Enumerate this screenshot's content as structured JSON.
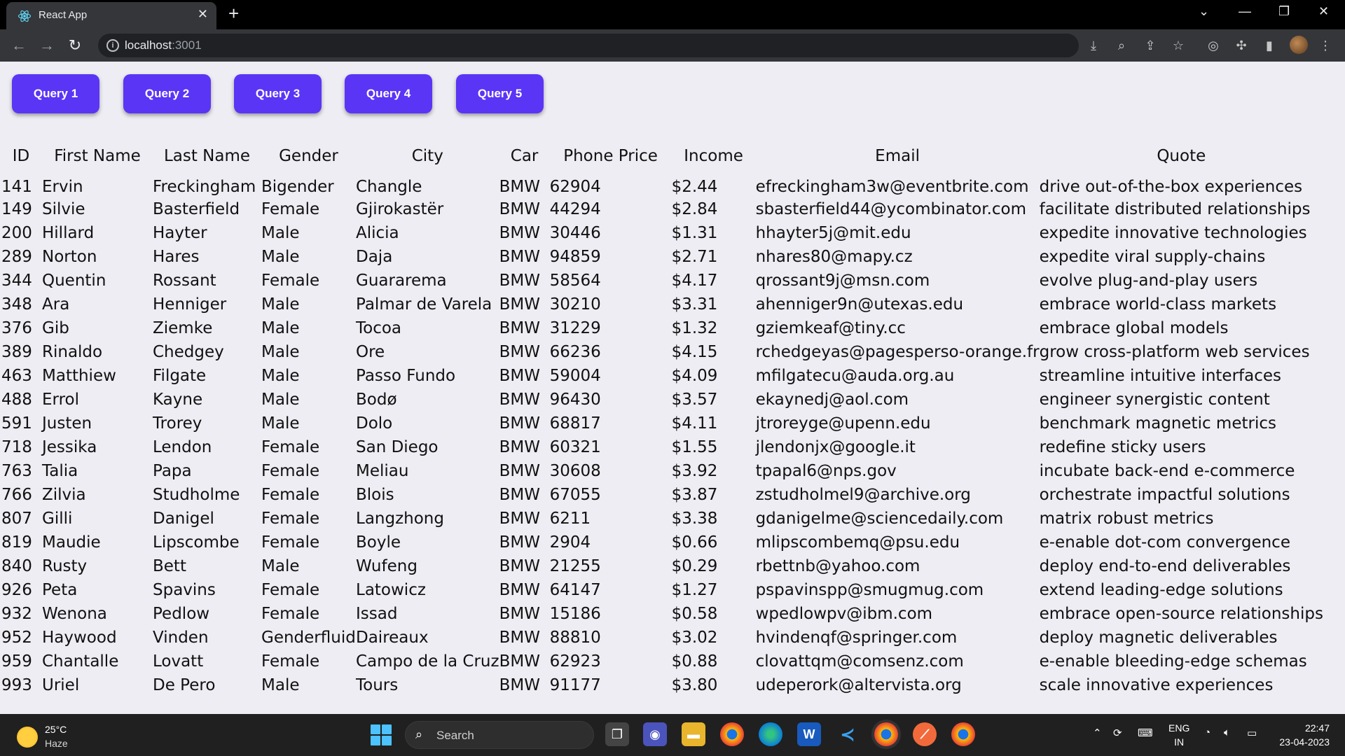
{
  "browser": {
    "tab_title": "React App",
    "tab_close": "✕",
    "new_tab": "+",
    "url_host": "localhost",
    "url_port": ":3001"
  },
  "queries": [
    "Query 1",
    "Query 2",
    "Query 3",
    "Query 4",
    "Query 5"
  ],
  "table": {
    "columns": [
      "ID",
      "First Name",
      "Last Name",
      "Gender",
      "City",
      "Car",
      "Phone Price",
      "Income",
      "Email",
      "Quote"
    ],
    "rows": [
      [
        "141",
        "Ervin",
        "Freckingham",
        "Bigender",
        "Changle",
        "BMW",
        "62904",
        "$2.44",
        "efreckingham3w@eventbrite.com",
        "drive out-of-the-box experiences"
      ],
      [
        "149",
        "Silvie",
        "Basterfield",
        "Female",
        "Gjirokastër",
        "BMW",
        "44294",
        "$2.84",
        "sbasterfield44@ycombinator.com",
        "facilitate distributed relationships"
      ],
      [
        "200",
        "Hillard",
        "Hayter",
        "Male",
        "Alicia",
        "BMW",
        "30446",
        "$1.31",
        "hhayter5j@mit.edu",
        "expedite innovative technologies"
      ],
      [
        "289",
        "Norton",
        "Hares",
        "Male",
        "Daja",
        "BMW",
        "94859",
        "$2.71",
        "nhares80@mapy.cz",
        "expedite viral supply-chains"
      ],
      [
        "344",
        "Quentin",
        "Rossant",
        "Female",
        "Guararema",
        "BMW",
        "58564",
        "$4.17",
        "qrossant9j@msn.com",
        "evolve plug-and-play users"
      ],
      [
        "348",
        "Ara",
        "Henniger",
        "Male",
        "Palmar de Varela",
        "BMW",
        "30210",
        "$3.31",
        "ahenniger9n@utexas.edu",
        "embrace world-class markets"
      ],
      [
        "376",
        "Gib",
        "Ziemke",
        "Male",
        "Tocoa",
        "BMW",
        "31229",
        "$1.32",
        "gziemkeaf@tiny.cc",
        "embrace global models"
      ],
      [
        "389",
        "Rinaldo",
        "Chedgey",
        "Male",
        "Ore",
        "BMW",
        "66236",
        "$4.15",
        "rchedgeyas@pagesperso-orange.fr",
        "grow cross-platform web services"
      ],
      [
        "463",
        "Matthiew",
        "Filgate",
        "Male",
        "Passo Fundo",
        "BMW",
        "59004",
        "$4.09",
        "mfilgatecu@auda.org.au",
        "streamline intuitive interfaces"
      ],
      [
        "488",
        "Errol",
        "Kayne",
        "Male",
        "Bodø",
        "BMW",
        "96430",
        "$3.57",
        "ekaynedj@aol.com",
        "engineer synergistic content"
      ],
      [
        "591",
        "Justen",
        "Trorey",
        "Male",
        "Dolo",
        "BMW",
        "68817",
        "$4.11",
        "jtroreyge@upenn.edu",
        "benchmark magnetic metrics"
      ],
      [
        "718",
        "Jessika",
        "Lendon",
        "Female",
        "San Diego",
        "BMW",
        "60321",
        "$1.55",
        "jlendonjx@google.it",
        "redefine sticky users"
      ],
      [
        "763",
        "Talia",
        "Papa",
        "Female",
        "Meliau",
        "BMW",
        "30608",
        "$3.92",
        "tpapal6@nps.gov",
        "incubate back-end e-commerce"
      ],
      [
        "766",
        "Zilvia",
        "Studholme",
        "Female",
        "Blois",
        "BMW",
        "67055",
        "$3.87",
        "zstudholmel9@archive.org",
        "orchestrate impactful solutions"
      ],
      [
        "807",
        "Gilli",
        "Danigel",
        "Female",
        "Langzhong",
        "BMW",
        "6211",
        "$3.38",
        "gdanigelme@sciencedaily.com",
        "matrix robust metrics"
      ],
      [
        "819",
        "Maudie",
        "Lipscombe",
        "Female",
        "Boyle",
        "BMW",
        "2904",
        "$0.66",
        "mlipscombemq@psu.edu",
        "e-enable dot-com convergence"
      ],
      [
        "840",
        "Rusty",
        "Bett",
        "Male",
        "Wufeng",
        "BMW",
        "21255",
        "$0.29",
        "rbettnb@yahoo.com",
        "deploy end-to-end deliverables"
      ],
      [
        "926",
        "Peta",
        "Spavins",
        "Female",
        "Latowicz",
        "BMW",
        "64147",
        "$1.27",
        "pspavinspp@smugmug.com",
        "extend leading-edge solutions"
      ],
      [
        "932",
        "Wenona",
        "Pedlow",
        "Female",
        "Issad",
        "BMW",
        "15186",
        "$0.58",
        "wpedlowpv@ibm.com",
        "embrace open-source relationships"
      ],
      [
        "952",
        "Haywood",
        "Vinden",
        "Genderfluid",
        "Daireaux",
        "BMW",
        "88810",
        "$3.02",
        "hvindenqf@springer.com",
        "deploy magnetic deliverables"
      ],
      [
        "959",
        "Chantalle",
        "Lovatt",
        "Female",
        "Campo de la Cruz",
        "BMW",
        "62923",
        "$0.88",
        "clovattqm@comsenz.com",
        "e-enable bleeding-edge schemas"
      ],
      [
        "993",
        "Uriel",
        "De Pero",
        "Male",
        "Tours",
        "BMW",
        "91177",
        "$3.80",
        "udeperork@altervista.org",
        "scale innovative experiences"
      ]
    ]
  },
  "taskbar": {
    "temperature": "25°C",
    "weather": "Haze",
    "search_label": "Search",
    "lang_line1": "ENG",
    "lang_line2": "IN",
    "time": "22:47",
    "date": "23-04-2023"
  },
  "colors": {
    "query_button": "#5a35f5",
    "page_background": "#ededf3",
    "browser_frame": "#35363a"
  }
}
